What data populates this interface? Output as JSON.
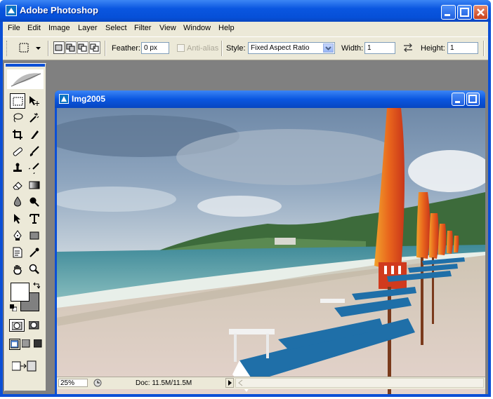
{
  "app": {
    "title": "Adobe Photoshop"
  },
  "menu": {
    "items": [
      "File",
      "Edit",
      "Image",
      "Layer",
      "Select",
      "Filter",
      "View",
      "Window",
      "Help"
    ]
  },
  "options": {
    "feather_label": "Feather:",
    "feather_value": "0 px",
    "antialias_label": "Anti-alias",
    "style_label": "Style:",
    "style_value": "Fixed Aspect Ratio",
    "width_label": "Width:",
    "width_value": "1",
    "height_label": "Height:",
    "height_value": "1"
  },
  "document": {
    "title": "Img2005",
    "zoom": "25%",
    "doc_info": "Doc: 11.5M/11.5M"
  },
  "colors": {
    "titlebar": "#0a56e0",
    "chrome": "#ece9d8",
    "workspace": "#808080"
  },
  "icons": [
    "rect-marquee-icon",
    "move-icon",
    "lasso-icon",
    "magic-wand-icon",
    "crop-icon",
    "slice-icon",
    "healing-brush-icon",
    "brush-icon",
    "clone-stamp-icon",
    "history-brush-icon",
    "eraser-icon",
    "gradient-icon",
    "blur-icon",
    "dodge-icon",
    "path-select-icon",
    "type-icon",
    "pen-icon",
    "shape-icon",
    "notes-icon",
    "eyedropper-icon",
    "hand-icon",
    "zoom-icon"
  ]
}
